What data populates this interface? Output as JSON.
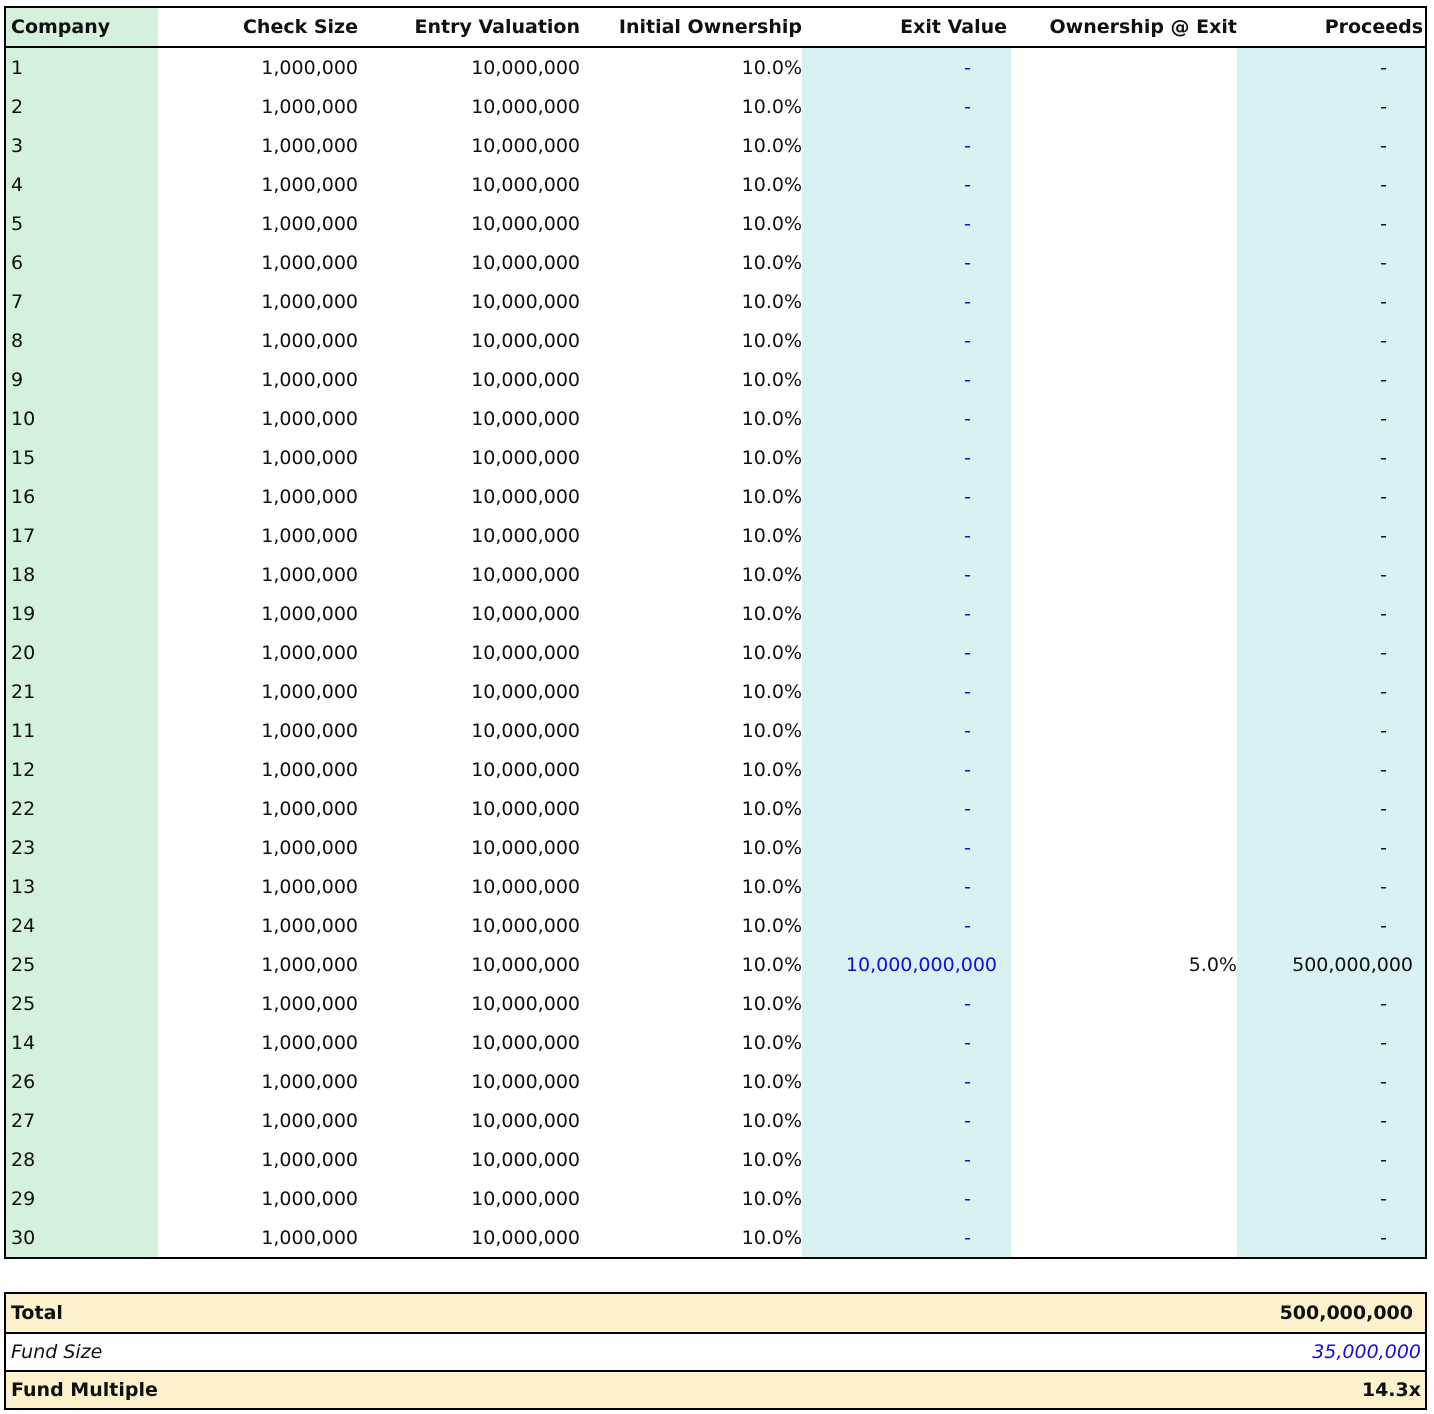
{
  "table": {
    "headers": {
      "company": "Company",
      "check_size": "Check Size",
      "entry_valuation": "Entry Valuation",
      "initial_ownership": "Initial Ownership",
      "exit_value": "Exit Value",
      "ownership_exit": "Ownership @ Exit",
      "proceeds": "Proceeds"
    },
    "rows": [
      {
        "company": "1",
        "check": "1,000,000",
        "entry": "10,000,000",
        "init": "10.0%",
        "exit": "-",
        "own": "",
        "proceeds": "-"
      },
      {
        "company": "2",
        "check": "1,000,000",
        "entry": "10,000,000",
        "init": "10.0%",
        "exit": "-",
        "own": "",
        "proceeds": "-"
      },
      {
        "company": "3",
        "check": "1,000,000",
        "entry": "10,000,000",
        "init": "10.0%",
        "exit": "-",
        "own": "",
        "proceeds": "-"
      },
      {
        "company": "4",
        "check": "1,000,000",
        "entry": "10,000,000",
        "init": "10.0%",
        "exit": "-",
        "own": "",
        "proceeds": "-"
      },
      {
        "company": "5",
        "check": "1,000,000",
        "entry": "10,000,000",
        "init": "10.0%",
        "exit": "-",
        "own": "",
        "proceeds": "-"
      },
      {
        "company": "6",
        "check": "1,000,000",
        "entry": "10,000,000",
        "init": "10.0%",
        "exit": "-",
        "own": "",
        "proceeds": "-"
      },
      {
        "company": "7",
        "check": "1,000,000",
        "entry": "10,000,000",
        "init": "10.0%",
        "exit": "-",
        "own": "",
        "proceeds": "-"
      },
      {
        "company": "8",
        "check": "1,000,000",
        "entry": "10,000,000",
        "init": "10.0%",
        "exit": "-",
        "own": "",
        "proceeds": "-"
      },
      {
        "company": "9",
        "check": "1,000,000",
        "entry": "10,000,000",
        "init": "10.0%",
        "exit": "-",
        "own": "",
        "proceeds": "-"
      },
      {
        "company": "10",
        "check": "1,000,000",
        "entry": "10,000,000",
        "init": "10.0%",
        "exit": "-",
        "own": "",
        "proceeds": "-"
      },
      {
        "company": "15",
        "check": "1,000,000",
        "entry": "10,000,000",
        "init": "10.0%",
        "exit": "-",
        "own": "",
        "proceeds": "-"
      },
      {
        "company": "16",
        "check": "1,000,000",
        "entry": "10,000,000",
        "init": "10.0%",
        "exit": "-",
        "own": "",
        "proceeds": "-"
      },
      {
        "company": "17",
        "check": "1,000,000",
        "entry": "10,000,000",
        "init": "10.0%",
        "exit": "-",
        "own": "",
        "proceeds": "-"
      },
      {
        "company": "18",
        "check": "1,000,000",
        "entry": "10,000,000",
        "init": "10.0%",
        "exit": "-",
        "own": "",
        "proceeds": "-"
      },
      {
        "company": "19",
        "check": "1,000,000",
        "entry": "10,000,000",
        "init": "10.0%",
        "exit": "-",
        "own": "",
        "proceeds": "-"
      },
      {
        "company": "20",
        "check": "1,000,000",
        "entry": "10,000,000",
        "init": "10.0%",
        "exit": "-",
        "own": "",
        "proceeds": "-"
      },
      {
        "company": "21",
        "check": "1,000,000",
        "entry": "10,000,000",
        "init": "10.0%",
        "exit": "-",
        "own": "",
        "proceeds": "-"
      },
      {
        "company": "11",
        "check": "1,000,000",
        "entry": "10,000,000",
        "init": "10.0%",
        "exit": "-",
        "own": "",
        "proceeds": "-"
      },
      {
        "company": "12",
        "check": "1,000,000",
        "entry": "10,000,000",
        "init": "10.0%",
        "exit": "-",
        "own": "",
        "proceeds": "-"
      },
      {
        "company": "22",
        "check": "1,000,000",
        "entry": "10,000,000",
        "init": "10.0%",
        "exit": "-",
        "own": "",
        "proceeds": "-"
      },
      {
        "company": "23",
        "check": "1,000,000",
        "entry": "10,000,000",
        "init": "10.0%",
        "exit": "-",
        "own": "",
        "proceeds": "-"
      },
      {
        "company": "13",
        "check": "1,000,000",
        "entry": "10,000,000",
        "init": "10.0%",
        "exit": "-",
        "own": "",
        "proceeds": "-"
      },
      {
        "company": "24",
        "check": "1,000,000",
        "entry": "10,000,000",
        "init": "10.0%",
        "exit": "-",
        "own": "",
        "proceeds": "-"
      },
      {
        "company": "25",
        "check": "1,000,000",
        "entry": "10,000,000",
        "init": "10.0%",
        "exit": "10,000,000,000",
        "own": "5.0%",
        "proceeds": "500,000,000"
      },
      {
        "company": "25",
        "check": "1,000,000",
        "entry": "10,000,000",
        "init": "10.0%",
        "exit": "-",
        "own": "",
        "proceeds": "-"
      },
      {
        "company": "14",
        "check": "1,000,000",
        "entry": "10,000,000",
        "init": "10.0%",
        "exit": "-",
        "own": "",
        "proceeds": "-"
      },
      {
        "company": "26",
        "check": "1,000,000",
        "entry": "10,000,000",
        "init": "10.0%",
        "exit": "-",
        "own": "",
        "proceeds": "-"
      },
      {
        "company": "27",
        "check": "1,000,000",
        "entry": "10,000,000",
        "init": "10.0%",
        "exit": "-",
        "own": "",
        "proceeds": "-"
      },
      {
        "company": "28",
        "check": "1,000,000",
        "entry": "10,000,000",
        "init": "10.0%",
        "exit": "-",
        "own": "",
        "proceeds": "-"
      },
      {
        "company": "29",
        "check": "1,000,000",
        "entry": "10,000,000",
        "init": "10.0%",
        "exit": "-",
        "own": "",
        "proceeds": "-"
      },
      {
        "company": "30",
        "check": "1,000,000",
        "entry": "10,000,000",
        "init": "10.0%",
        "exit": "-",
        "own": "",
        "proceeds": "-"
      }
    ]
  },
  "summary": {
    "total_label": "Total",
    "total_value": "500,000,000",
    "fund_size_label": "Fund Size",
    "fund_size_value": "35,000,000",
    "multiple_label": "Fund Multiple",
    "multiple_value": "14.3x"
  },
  "colors": {
    "company_column": "#d3f1dc",
    "output_columns": "#d8f1f1",
    "summary_highlight": "#fef2cd",
    "input_text": "#1010d8"
  }
}
